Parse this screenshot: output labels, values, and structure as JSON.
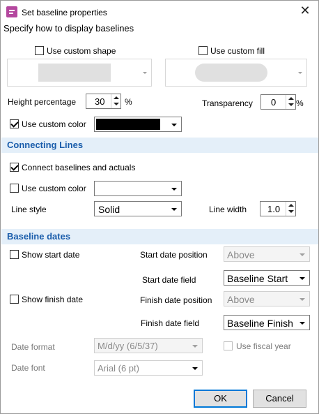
{
  "window": {
    "title": "Set baseline properties",
    "subtitle": "Specify how to display baselines"
  },
  "shape": {
    "use_custom_shape_label": "Use custom shape",
    "use_custom_fill_label": "Use custom fill"
  },
  "height": {
    "label": "Height percentage",
    "value": "30",
    "unit": "%"
  },
  "transparency": {
    "label": "Transparency",
    "value": "0",
    "unit": "%"
  },
  "custom_color": {
    "label": "Use custom color",
    "color": "#000000"
  },
  "connecting": {
    "header": "Connecting Lines",
    "connect_label": "Connect baselines and actuals",
    "use_custom_color_label": "Use custom color",
    "line_style_label": "Line style",
    "line_style_value": "Solid",
    "line_width_label": "Line width",
    "line_width_value": "1.0"
  },
  "dates": {
    "header": "Baseline dates",
    "show_start_label": "Show start date",
    "start_position_label": "Start date position",
    "start_position_value": "Above",
    "start_field_label": "Start date field",
    "start_field_value": "Baseline Start",
    "show_finish_label": "Show finish date",
    "finish_position_label": "Finish date position",
    "finish_position_value": "Above",
    "finish_field_label": "Finish date field",
    "finish_field_value": "Baseline Finish",
    "date_format_label": "Date format",
    "date_format_value": "M/d/yy (6/5/37)",
    "fiscal_label": "Use fiscal year",
    "date_font_label": "Date font",
    "date_font_value": "Arial (6 pt)"
  },
  "buttons": {
    "ok": "OK",
    "cancel": "Cancel"
  },
  "colors": {
    "section_bg": "#e4eff9",
    "section_text": "#1a5dab",
    "accent": "#0078d7",
    "title_icon": "#b4479e"
  }
}
